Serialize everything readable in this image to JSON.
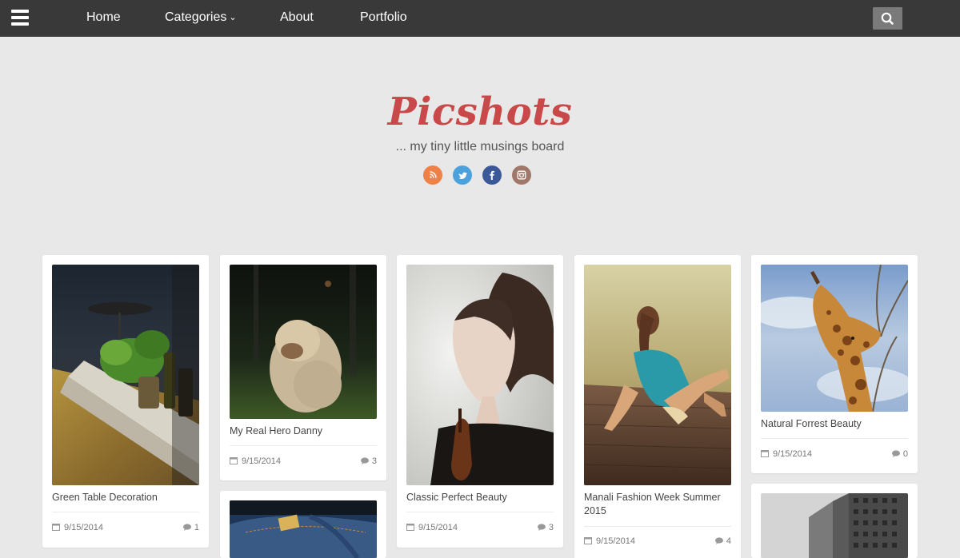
{
  "nav": {
    "menu_icon": "hamburger-menu-icon",
    "items": [
      {
        "label": "Home"
      },
      {
        "label": "Categories",
        "has_dropdown": true
      },
      {
        "label": "About"
      },
      {
        "label": "Portfolio"
      }
    ],
    "search_icon": "search-icon"
  },
  "header": {
    "title": "Picshots",
    "tagline": "... my tiny little musings board",
    "social": [
      {
        "name": "rss-icon",
        "color": "#ee8148"
      },
      {
        "name": "twitter-icon",
        "color": "#4ba1dc"
      },
      {
        "name": "facebook-icon",
        "color": "#3b5998"
      },
      {
        "name": "instagram-icon",
        "color": "#a0786a"
      }
    ]
  },
  "cards": [
    {
      "title": "Green Table Decoration",
      "date": "9/15/2014",
      "comments": "1"
    },
    {
      "title": "My Real Hero Danny",
      "date": "9/15/2014",
      "comments": "3"
    },
    {
      "title": "Classic Perfect Beauty",
      "date": "9/15/2014",
      "comments": "3"
    },
    {
      "title": "Manali Fashion Week Summer 2015",
      "date": "9/15/2014",
      "comments": "4"
    },
    {
      "title": "Natural Forrest Beauty",
      "date": "9/15/2014",
      "comments": "0"
    }
  ]
}
